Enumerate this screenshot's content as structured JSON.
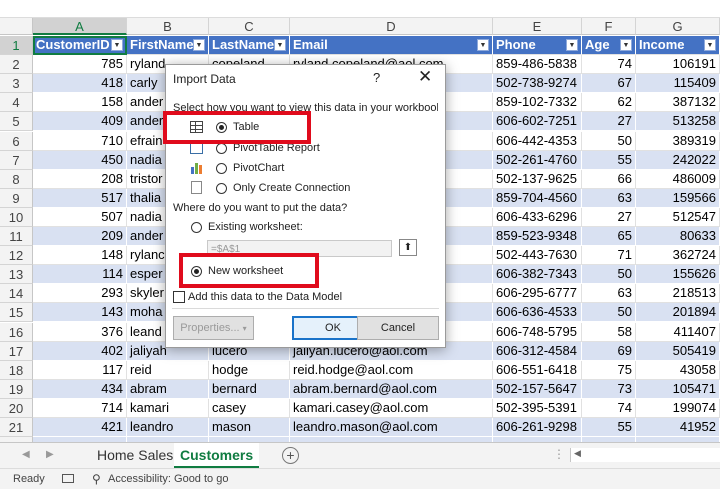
{
  "columns": [
    "A",
    "B",
    "C",
    "D",
    "E",
    "F",
    "G"
  ],
  "header_row": {
    "row": "1",
    "cells": [
      "CustomerID",
      "FirstName",
      "LastName",
      "Email",
      "Phone",
      "Age",
      "Income"
    ]
  },
  "rows": [
    {
      "row": "2",
      "cells": [
        "785",
        "ryland",
        "copeland",
        "ryland.copeland@aol.com",
        "859-486-5838",
        "74",
        "106191"
      ]
    },
    {
      "row": "3",
      "cells": [
        "418",
        "carly",
        "",
        "",
        "502-738-9274",
        "67",
        "115409"
      ]
    },
    {
      "row": "4",
      "cells": [
        "158",
        "ander",
        "",
        "ol.com",
        "859-102-7332",
        "62",
        "387132"
      ]
    },
    {
      "row": "5",
      "cells": [
        "409",
        "ander",
        "",
        "",
        "606-602-7251",
        "27",
        "513258"
      ]
    },
    {
      "row": "6",
      "cells": [
        "710",
        "efrain",
        "",
        "",
        "606-442-4353",
        "50",
        "389319"
      ]
    },
    {
      "row": "7",
      "cells": [
        "450",
        "nadia",
        "",
        "",
        "502-261-4760",
        "55",
        "242022"
      ]
    },
    {
      "row": "8",
      "cells": [
        "208",
        "tristor",
        "",
        "n",
        "502-137-9625",
        "66",
        "486009"
      ]
    },
    {
      "row": "9",
      "cells": [
        "517",
        "thalia",
        "",
        "",
        "859-704-4560",
        "63",
        "159566"
      ]
    },
    {
      "row": "10",
      "cells": [
        "507",
        "nadia",
        "",
        "",
        "606-433-6296",
        "27",
        "512547"
      ]
    },
    {
      "row": "11",
      "cells": [
        "209",
        "ander",
        "",
        "n",
        "859-523-9348",
        "65",
        "80633"
      ]
    },
    {
      "row": "12",
      "cells": [
        "148",
        "rylanc",
        "",
        "",
        "502-443-7630",
        "71",
        "362724"
      ]
    },
    {
      "row": "13",
      "cells": [
        "114",
        "esper",
        "",
        "l.com",
        "606-382-7343",
        "50",
        "155626"
      ]
    },
    {
      "row": "14",
      "cells": [
        "293",
        "skyler",
        "",
        "",
        "606-295-6777",
        "63",
        "218513"
      ]
    },
    {
      "row": "15",
      "cells": [
        "143",
        "moha",
        "",
        "om",
        "606-636-4533",
        "50",
        "201894"
      ]
    },
    {
      "row": "16",
      "cells": [
        "376",
        "leand",
        "",
        "",
        "606-748-5795",
        "58",
        "411407"
      ]
    },
    {
      "row": "17",
      "cells": [
        "402",
        "jaliyah",
        "lucero",
        "jaliyah.lucero@aol.com",
        "606-312-4584",
        "69",
        "505419"
      ]
    },
    {
      "row": "18",
      "cells": [
        "117",
        "reid",
        "hodge",
        "reid.hodge@aol.com",
        "606-551-6418",
        "75",
        "43058"
      ]
    },
    {
      "row": "19",
      "cells": [
        "434",
        "abram",
        "bernard",
        "abram.bernard@aol.com",
        "502-157-5647",
        "73",
        "105471"
      ]
    },
    {
      "row": "20",
      "cells": [
        "714",
        "kamari",
        "casey",
        "kamari.casey@aol.com",
        "502-395-5391",
        "74",
        "199074"
      ]
    },
    {
      "row": "21",
      "cells": [
        "421",
        "leandro",
        "mason",
        "leandro.mason@aol.com",
        "606-261-9298",
        "55",
        "41952"
      ]
    }
  ],
  "sheet_tabs": {
    "inactive": "Home Sales",
    "active": "Customers"
  },
  "status": {
    "ready": "Ready",
    "accessibility": "Accessibility: Good to go"
  },
  "dialog": {
    "title": "Import Data",
    "help": "?",
    "close": "✕",
    "view_prompt_visible": "Select how you want to view this data in your workbook.",
    "options": {
      "table": "Table",
      "pivot_table": "PivotTable Report",
      "pivot_chart": "PivotChart",
      "connection": "Only Create Connection"
    },
    "where_prompt": "Where do you want to put the data?",
    "existing": "Existing worksheet:",
    "address": "=$A$1",
    "new_worksheet": "New worksheet",
    "data_model": "Add this data to the Data Model",
    "properties": "Properties...",
    "ok": "OK",
    "cancel": "Cancel",
    "selected_view": "table",
    "selected_location": "new"
  },
  "colors": {
    "header_blue": "#4472c4",
    "band": "#d9e1f2",
    "excel_green": "#107c41",
    "highlight_red": "#e00b1c"
  }
}
